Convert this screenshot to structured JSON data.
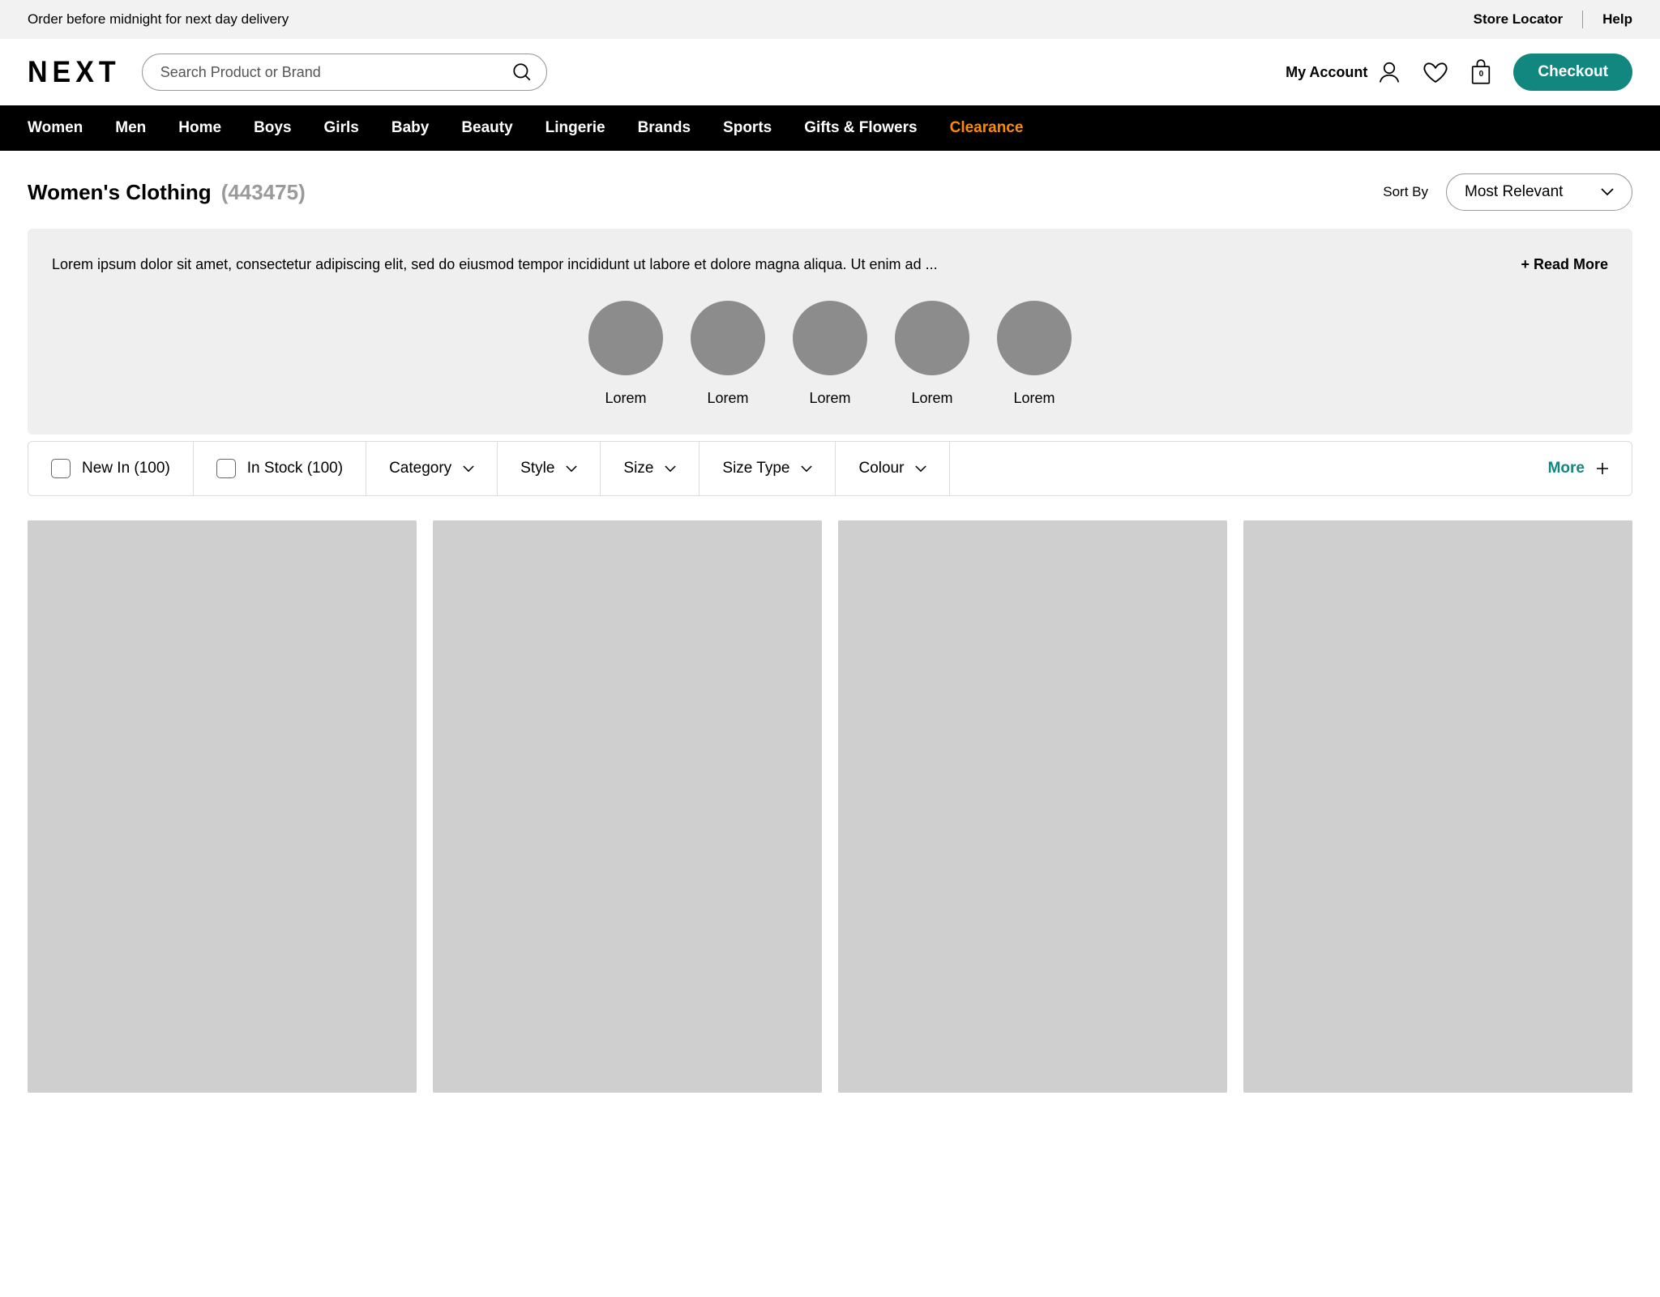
{
  "promo": {
    "message": "Order before midnight for next day delivery",
    "store_locator": "Store Locator",
    "help": "Help"
  },
  "header": {
    "logo": "NEXT",
    "search_placeholder": "Search Product or Brand",
    "account_label": "My Account",
    "bag_count": "0",
    "checkout_label": "Checkout"
  },
  "nav": {
    "items": [
      "Women",
      "Men",
      "Home",
      "Boys",
      "Girls",
      "Baby",
      "Beauty",
      "Lingerie",
      "Brands",
      "Sports",
      "Gifts & Flowers",
      "Clearance"
    ]
  },
  "title": {
    "heading": "Women's Clothing",
    "count": "(443475)",
    "sort_label": "Sort By",
    "sort_value": "Most Relevant"
  },
  "desc": {
    "text": "Lorem ipsum dolor sit amet, consectetur adipiscing elit, sed do eiusmod tempor incididunt ut labore et dolore magna aliqua. Ut enim ad ...",
    "read_more": "+ Read More",
    "circles": [
      "Lorem",
      "Lorem",
      "Lorem",
      "Lorem",
      "Lorem"
    ]
  },
  "filters": {
    "new_in": "New In (100)",
    "in_stock": "In Stock (100)",
    "dropdowns": [
      "Category",
      "Style",
      "Size",
      "Size Type",
      "Colour"
    ],
    "more": "More"
  },
  "colors": {
    "accent": "#118780",
    "clearance": "#ff8a00"
  }
}
